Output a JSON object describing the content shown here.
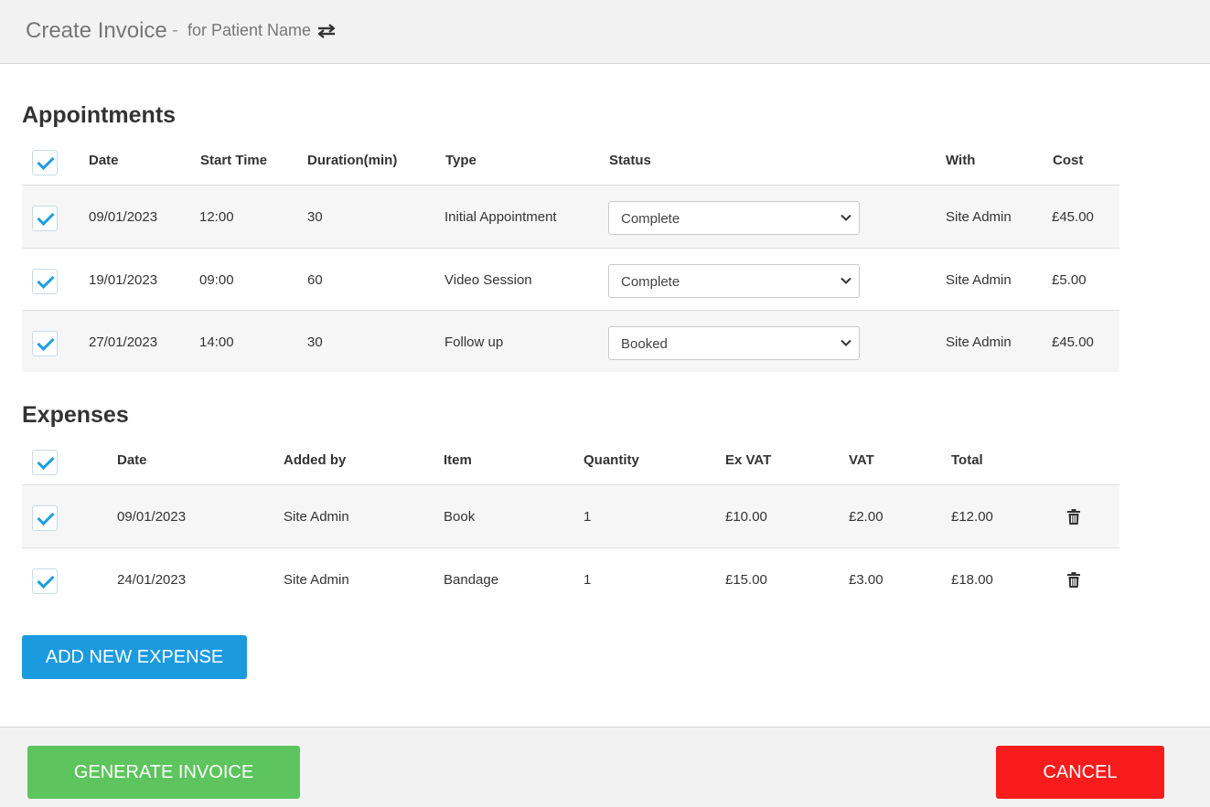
{
  "header": {
    "title": "Create Invoice",
    "separator": "-",
    "subtitle": "for Patient Name",
    "swap_icon": "swap-arrows-icon"
  },
  "appointments": {
    "title": "Appointments",
    "columns": {
      "date": "Date",
      "start_time": "Start Time",
      "duration": "Duration(min)",
      "type": "Type",
      "status": "Status",
      "with": "With",
      "cost": "Cost"
    },
    "select_all_checked": true,
    "rows": [
      {
        "checked": true,
        "date": "09/01/2023",
        "start_time": "12:00",
        "duration": "30",
        "type": "Initial Appointment",
        "status": "Complete",
        "with": "Site Admin",
        "cost": "£45.00"
      },
      {
        "checked": true,
        "date": "19/01/2023",
        "start_time": "09:00",
        "duration": "60",
        "type": "Video Session",
        "status": "Complete",
        "with": "Site Admin",
        "cost": "£5.00"
      },
      {
        "checked": true,
        "date": "27/01/2023",
        "start_time": "14:00",
        "duration": "30",
        "type": "Follow up",
        "status": "Booked",
        "with": "Site Admin",
        "cost": "£45.00"
      }
    ]
  },
  "expenses": {
    "title": "Expenses",
    "columns": {
      "date": "Date",
      "added_by": "Added by",
      "item": "Item",
      "quantity": "Quantity",
      "ex_vat": "Ex VAT",
      "vat": "VAT",
      "total": "Total"
    },
    "select_all_checked": true,
    "rows": [
      {
        "checked": true,
        "date": "09/01/2023",
        "added_by": "Site Admin",
        "item": "Book",
        "quantity": "1",
        "ex_vat": "£10.00",
        "vat": "£2.00",
        "total": "£12.00"
      },
      {
        "checked": true,
        "date": "24/01/2023",
        "added_by": "Site Admin",
        "item": "Bandage",
        "quantity": "1",
        "ex_vat": "£15.00",
        "vat": "£3.00",
        "total": "£18.00"
      }
    ],
    "delete_icon": "trash-icon",
    "add_button": "ADD NEW EXPENSE"
  },
  "footer": {
    "generate_button": "GENERATE INVOICE",
    "cancel_button": "CANCEL"
  },
  "colors": {
    "accent_blue": "#1c9ae0",
    "generate_green": "#5ec45e",
    "cancel_red": "#f81c1c",
    "header_bg": "#f2f2f2"
  }
}
